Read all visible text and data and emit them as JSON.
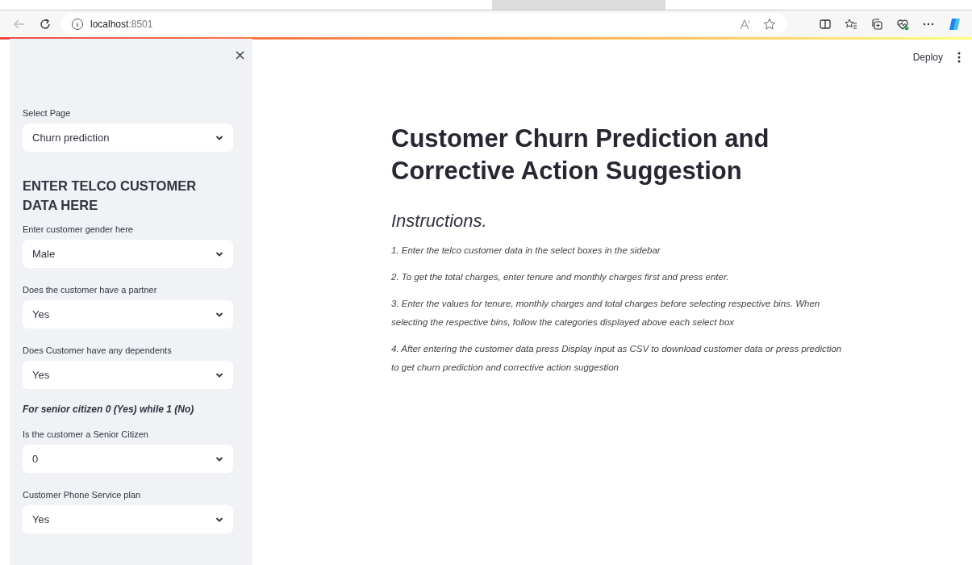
{
  "browser": {
    "host": "localhost",
    "port": ":8501"
  },
  "toolbar": {
    "deploy": "Deploy"
  },
  "sidebar": {
    "items": [
      {
        "kind": "select",
        "label": "Select Page",
        "value": "Churn prediction"
      },
      {
        "kind": "heading",
        "text": "ENTER TELCO CUSTOMER DATA HERE"
      },
      {
        "kind": "select",
        "label": "Enter customer gender here",
        "value": "Male"
      },
      {
        "kind": "select",
        "label": "Does the customer have a partner",
        "value": "Yes"
      },
      {
        "kind": "select",
        "label": "Does Customer have any dependents",
        "value": "Yes"
      },
      {
        "kind": "note",
        "text": "For senior citizen 0 (Yes) while 1 (No)"
      },
      {
        "kind": "select",
        "label": "Is the customer a Senior Citizen",
        "value": "0"
      },
      {
        "kind": "select",
        "label": "Customer Phone Service plan",
        "value": "Yes"
      }
    ]
  },
  "main": {
    "title": "Customer Churn Prediction and Corrective Action Suggestion",
    "subtitle": "Instructions.",
    "instructions": [
      "1. Enter the telco customer data in the select boxes in the sidebar",
      "2. To get the total charges, enter tenure and monthly charges first and press enter.",
      "3. Enter the values for tenure, monthly charges and total charges before selecting respective bins. When selecting the respective bins, follow the categories displayed above each select box",
      "4. After entering the customer data press Display input as CSV to download customer data or press prediction to get churn prediction and corrective action suggestion"
    ]
  }
}
